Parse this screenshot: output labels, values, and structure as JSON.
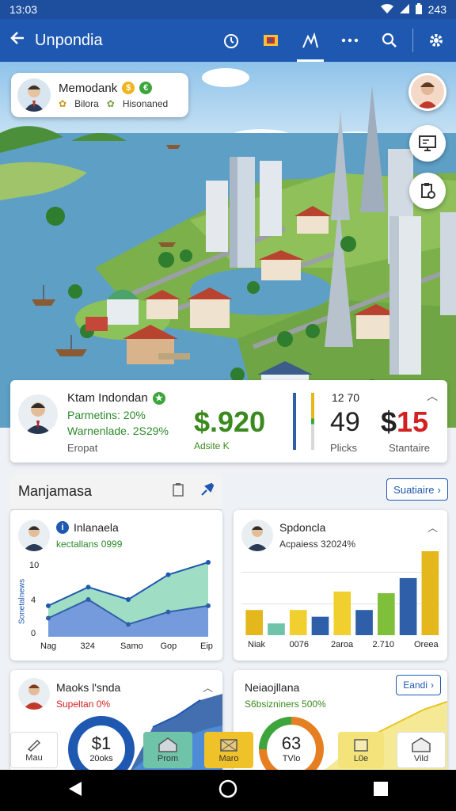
{
  "status_bar": {
    "time": "13:03",
    "battery": "243"
  },
  "app_bar": {
    "title": "Unpondia"
  },
  "city_card": {
    "name": "Memodank",
    "line2_a": "Bilora",
    "line2_b": "Hisonaned",
    "colors": {
      "coin_gold": "#f0b41c",
      "coin_green": "#3ca63c"
    }
  },
  "summary": {
    "name": "Ktam Indondan",
    "line2": "Parmetins: 20%",
    "line3": "Warnenlade. 2S29%",
    "line4": "Eropat",
    "big_value": "$.920",
    "big_sub": "Adsite K",
    "small_label": "12 70",
    "value_49": "49",
    "label_49": "Plicks",
    "value_15_dollar": "$",
    "value_15": "15",
    "label_15": "Stantaire"
  },
  "section": {
    "title": "Manjamasa",
    "stats_button": "Suatiaire"
  },
  "card_line": {
    "title": "Inlanaela",
    "subtitle": "kectallans 0999",
    "ylabel": "Sonetalnews",
    "yticks": [
      "10",
      "4",
      "0"
    ],
    "xticks": [
      "Nag",
      "324",
      "Samo",
      "Gop",
      "Eip"
    ]
  },
  "card_bar": {
    "title": "Spdoncla",
    "subtitle": "Acpaiess 32024%",
    "xticks": [
      "Niak",
      "0076",
      "2aroa",
      "2.710",
      "Oreea"
    ]
  },
  "card_donut1": {
    "title": "Maoks l'snda",
    "subtitle": "Supeltan 0%",
    "value": "$1",
    "sub": "20oks"
  },
  "card_donut2": {
    "title": "Neiaojllana",
    "subtitle": "S6bsizniners 500%",
    "button": "Eandi",
    "value": "63",
    "sub": "TVlo"
  },
  "bottom_tabs": [
    {
      "label": "Mau"
    },
    {
      "label": "Prom"
    },
    {
      "label": "Maro"
    },
    {
      "label": "L0e"
    },
    {
      "label": "Vild"
    }
  ],
  "chart_data": [
    {
      "type": "area",
      "title": "Inlanaela",
      "ylabel": "Sonetalnews",
      "categories": [
        "Nag",
        "324",
        "Samo",
        "Gop",
        "Eip"
      ],
      "ylim": [
        0,
        12
      ],
      "series": [
        {
          "values": [
            5,
            8,
            6,
            10,
            12
          ]
        },
        {
          "values": [
            3,
            6,
            2,
            4,
            5
          ]
        }
      ]
    },
    {
      "type": "bar",
      "title": "Spdoncla",
      "categories": [
        "Niak",
        "0076",
        "2aroa",
        "2.710",
        "Oreea"
      ],
      "values": [
        30,
        14,
        30,
        22,
        52,
        30,
        50,
        68,
        100
      ],
      "colors": [
        "#e4b81c",
        "#6fc3a8",
        "#f0cf2e",
        "#2f5fa8",
        "#f0cf2e",
        "#2f5fa8",
        "#7ec03a",
        "#2f5fa8",
        "#e4b81c"
      ]
    }
  ]
}
